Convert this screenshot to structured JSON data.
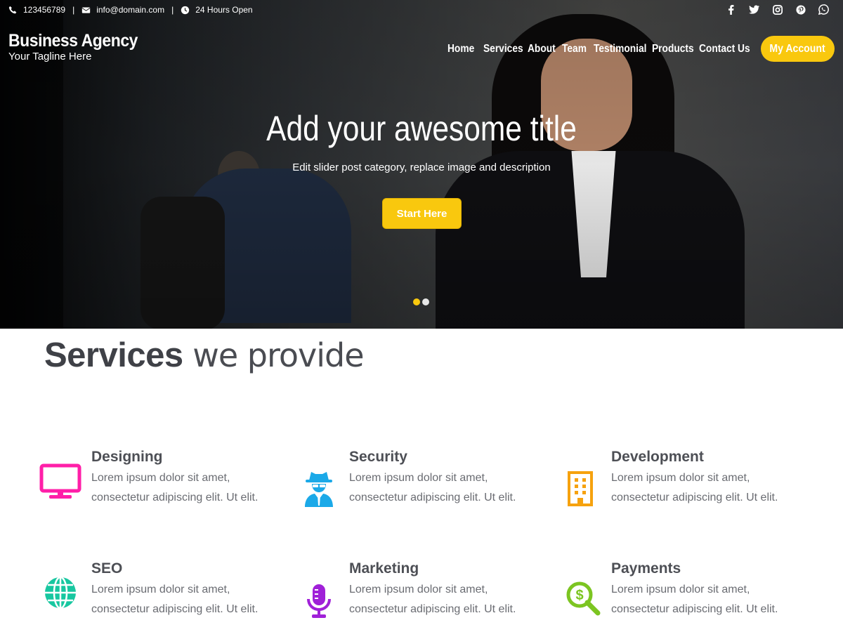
{
  "topbar": {
    "phone": "123456789",
    "email": "info@domain.com",
    "hours": "24 Hours Open",
    "separator": "|",
    "social": [
      "facebook-icon",
      "twitter-icon",
      "instagram-icon",
      "pinterest-icon",
      "whatsapp-icon"
    ]
  },
  "brand": {
    "title": "Business Agency",
    "tagline": "Your Tagline Here"
  },
  "nav": {
    "items": [
      "Home",
      "Services",
      "About",
      "Team",
      "Testimonial",
      "Products",
      "Contact Us"
    ],
    "account": "My Account"
  },
  "hero": {
    "title": "Add your awesome title",
    "subtitle": "Edit slider post category, replace image and description",
    "button": "Start Here",
    "slides": 2,
    "active_slide": 1
  },
  "services": {
    "heading_bold": "Services",
    "heading_light": "we provide",
    "items": [
      {
        "name": "Designing",
        "line1": "Lorem ipsum dolor sit amet,",
        "line2": "consectetur adipiscing elit. Ut elit.",
        "icon": "monitor-icon",
        "color": "#ff1fa8"
      },
      {
        "name": "Security",
        "line1": "Lorem ipsum dolor sit amet,",
        "line2": "consectetur adipiscing elit. Ut elit.",
        "icon": "user-secret-icon",
        "color": "#1ba9e8"
      },
      {
        "name": "Development",
        "line1": "Lorem ipsum dolor sit amet,",
        "line2": "consectetur adipiscing elit. Ut elit.",
        "icon": "building-icon",
        "color": "#f6a20e"
      },
      {
        "name": "SEO",
        "line1": "Lorem ipsum dolor sit amet,",
        "line2": "consectetur adipiscing elit. Ut elit.",
        "icon": "globe-icon",
        "color": "#17c7a0"
      },
      {
        "name": "Marketing",
        "line1": "Lorem ipsum dolor sit amet,",
        "line2": "consectetur adipiscing elit. Ut elit.",
        "icon": "microphone-icon",
        "color": "#a020d8"
      },
      {
        "name": "Payments",
        "line1": "Lorem ipsum dolor sit amet,",
        "line2": "consectetur adipiscing elit. Ut elit.",
        "icon": "search-dollar-icon",
        "color": "#7cc521"
      }
    ]
  },
  "colors": {
    "accent": "#f9c80e",
    "heading": "#3f4147",
    "text": "#6a6c72"
  }
}
